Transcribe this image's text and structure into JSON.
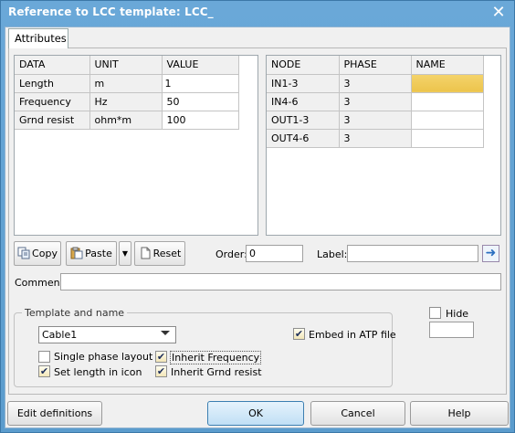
{
  "window": {
    "title": "Reference to LCC template: LCC_",
    "close_icon": "close-icon"
  },
  "tabs": [
    {
      "label": "Attributes"
    }
  ],
  "data_grid": {
    "headers": [
      "DATA",
      "UNIT",
      "VALUE"
    ],
    "rows": [
      [
        "Length",
        "m",
        "1"
      ],
      [
        "Frequency",
        "Hz",
        "50"
      ],
      [
        "Grnd resist",
        "ohm*m",
        "100"
      ]
    ]
  },
  "node_grid": {
    "headers": [
      "NODE",
      "PHASE",
      "NAME"
    ],
    "rows": [
      [
        "IN1-3",
        "3",
        ""
      ],
      [
        "IN4-6",
        "3",
        ""
      ],
      [
        "OUT1-3",
        "3",
        ""
      ],
      [
        "OUT4-6",
        "3",
        ""
      ]
    ]
  },
  "toolbar": {
    "copy_label": "Copy",
    "paste_label": "Paste",
    "reset_label": "Reset",
    "order_label": "Order:",
    "order_value": "0",
    "label_label": "Label:",
    "label_value": ""
  },
  "comment": {
    "label": "Comment:",
    "value": ""
  },
  "template_group": {
    "legend": "Template and name",
    "template_selected": "Cable1",
    "checkboxes": {
      "single_phase": {
        "label": "Single phase layout",
        "checked": false
      },
      "set_length": {
        "label": "Set length in icon",
        "checked": true
      },
      "inherit_frequency": {
        "label": "Inherit Frequency",
        "checked": true
      },
      "inherit_grnd": {
        "label": "Inherit Grnd resist",
        "checked": true
      },
      "embed_atp": {
        "label": "Embed in ATP file",
        "checked": true
      }
    }
  },
  "hide": {
    "label": "Hide",
    "checked": false,
    "value": ""
  },
  "buttons": {
    "edit_definitions": "Edit definitions",
    "ok": "OK",
    "cancel": "Cancel",
    "help": "Help"
  },
  "colors": {
    "title_bar": "#5b9ccd",
    "selected_cell": "#ecc44c",
    "ok_button": "#c0dff5"
  }
}
